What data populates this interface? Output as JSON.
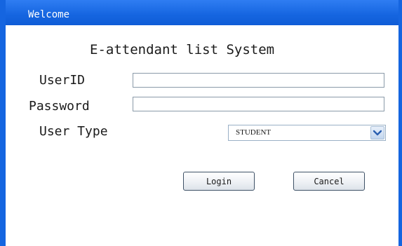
{
  "window": {
    "title": "Welcome"
  },
  "form": {
    "heading": "E-attendant list System",
    "userid_label": "UserID",
    "userid_value": "",
    "password_label": "Password",
    "password_value": "",
    "usertype_label": "User Type",
    "usertype_selected": "STUDENT"
  },
  "buttons": {
    "login": "Login",
    "cancel": "Cancel"
  },
  "icons": {
    "dropdown": "chevron-down-icon"
  },
  "colors": {
    "titlebar": "#1565e0",
    "title_text": "#ffffff",
    "dropdown_chevron": "#2a5fb0"
  }
}
